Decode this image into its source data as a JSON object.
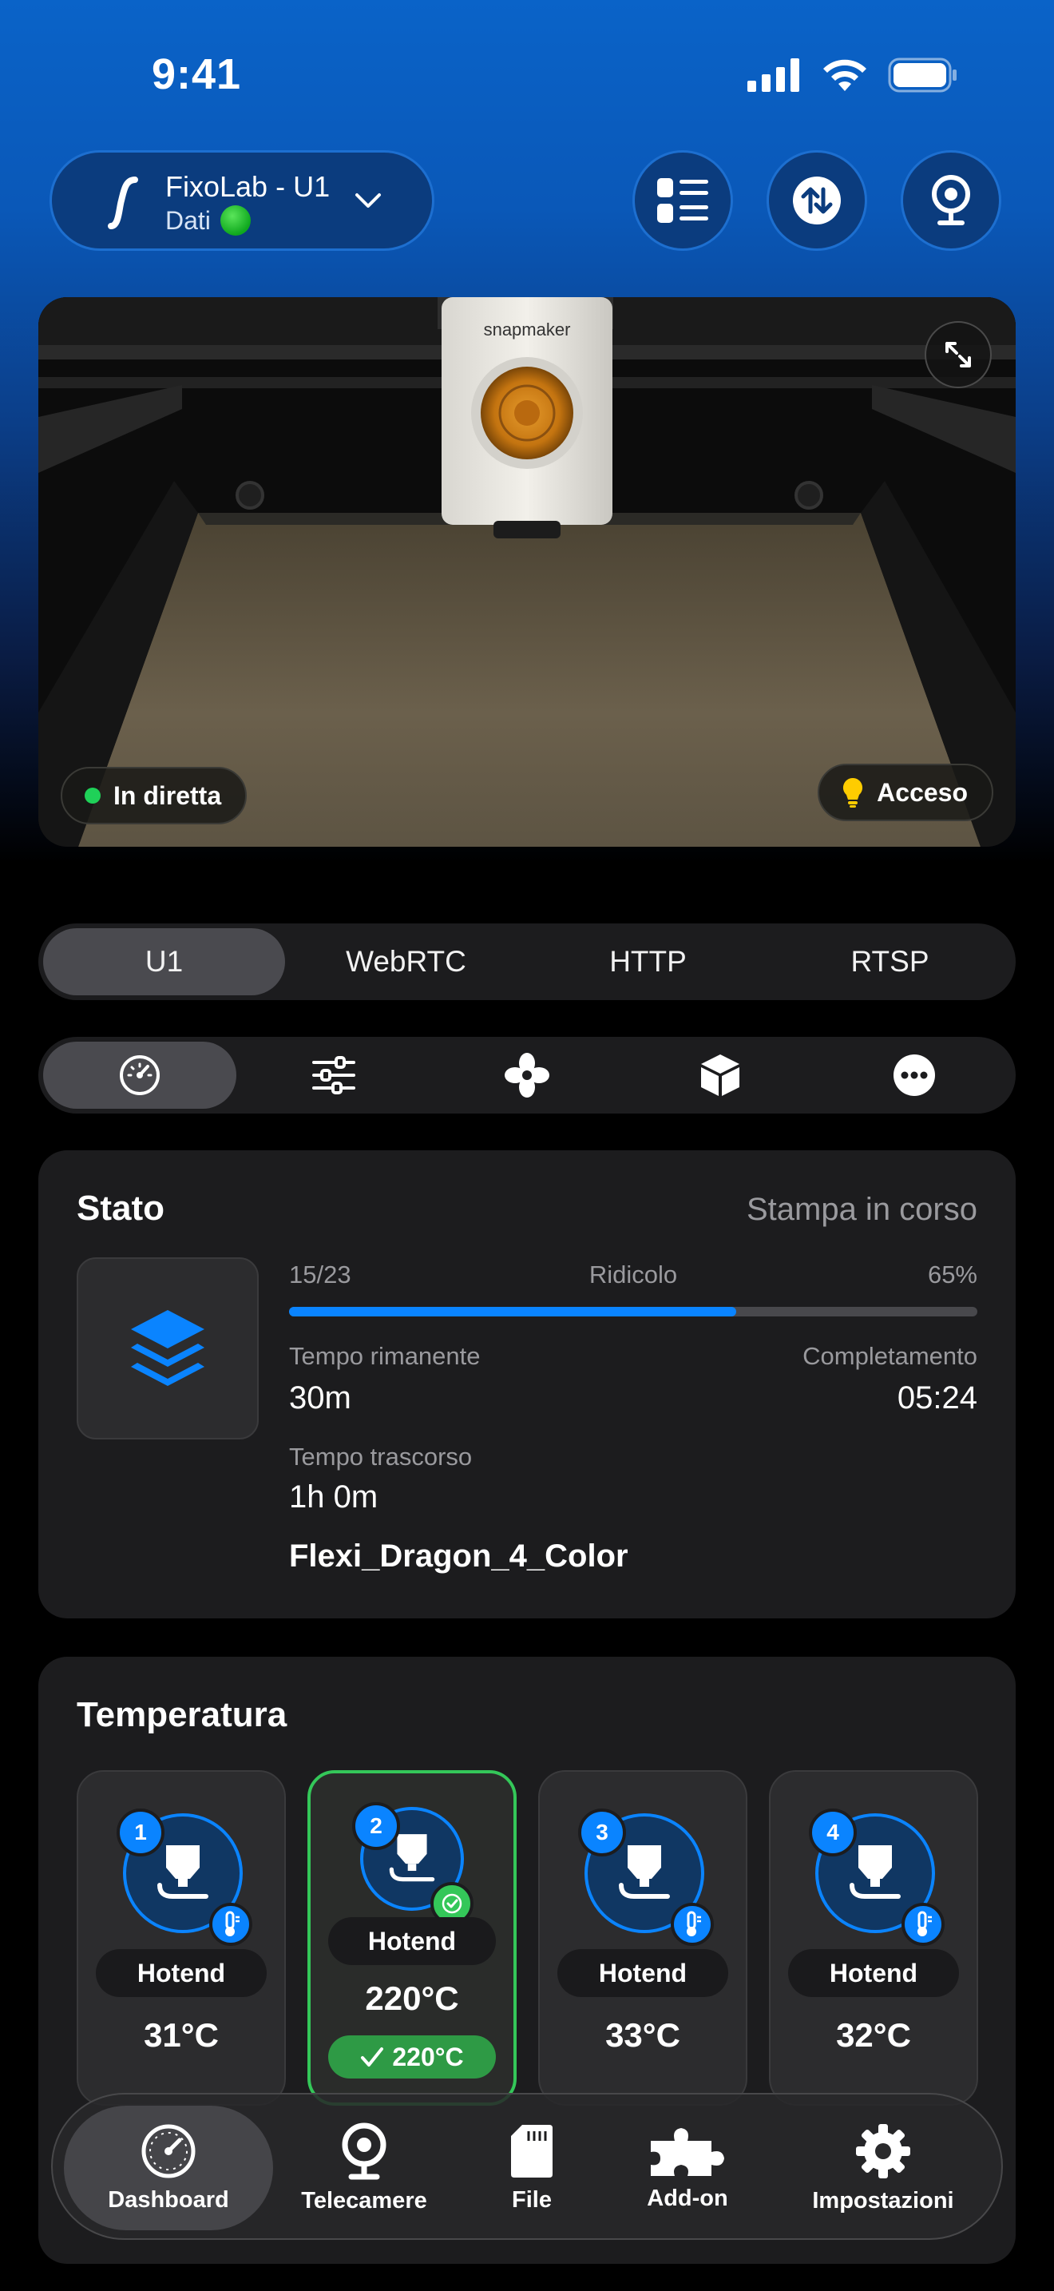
{
  "status_bar": {
    "time": "9:41"
  },
  "printer": {
    "name": "FixoLab - U1",
    "subtitle": "Dati"
  },
  "camera": {
    "live_label": "In diretta",
    "light_label": "Acceso",
    "brand_text": "snapmaker"
  },
  "stream_tabs": [
    "U1",
    "WebRTC",
    "HTTP",
    "RTSP"
  ],
  "tool_tabs": [
    "dashboard-gauge-icon",
    "sliders-icon",
    "fan-icon",
    "box-icon",
    "more-icon"
  ],
  "state": {
    "title": "Stato",
    "value": "Stampa in corso",
    "layers": "15/23",
    "speed_profile": "Ridicolo",
    "progress_label": "65%",
    "progress": 0.65,
    "remaining_label": "Tempo rimanente",
    "remaining": "30m",
    "completion_label": "Completamento",
    "completion": "05:24",
    "elapsed_label": "Tempo trascorso",
    "elapsed": "1h 0m",
    "file_name": "Flexi_Dragon_4_Color"
  },
  "temperature": {
    "title": "Temperatura",
    "hotends": [
      {
        "number": "1",
        "label": "Hotend",
        "temp": "31°C",
        "selected": false
      },
      {
        "number": "2",
        "label": "Hotend",
        "temp": "220°C",
        "target": "220°C",
        "selected": true
      },
      {
        "number": "3",
        "label": "Hotend",
        "temp": "33°C",
        "selected": false
      },
      {
        "number": "4",
        "label": "Hotend",
        "temp": "32°C",
        "selected": false
      }
    ]
  },
  "nav": {
    "dashboard": "Dashboard",
    "cameras": "Telecamere",
    "files": "File",
    "addons": "Add-on",
    "settings": "Impostazioni"
  },
  "colors": {
    "accent": "#0a84ff",
    "success": "#34c759",
    "card": "#1c1c1e"
  }
}
